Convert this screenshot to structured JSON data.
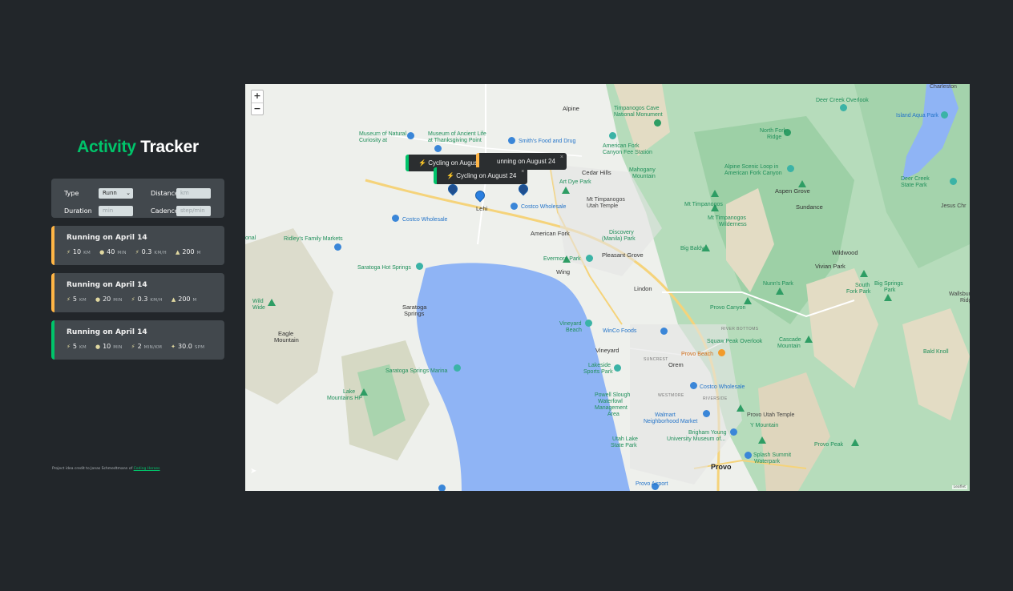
{
  "app": {
    "title_part1": "Activity",
    "title_part2": "Tracker"
  },
  "form": {
    "type_label": "Type",
    "type_value": "Runn",
    "distance_label": "Distance",
    "distance_placeholder": "km",
    "duration_label": "Duration",
    "duration_placeholder": "min",
    "cadence_label": "Cadence",
    "cadence_placeholder": "step/min"
  },
  "workouts": [
    {
      "title": "Running on April 14",
      "type": "running",
      "details": [
        {
          "icon": "runner-icon",
          "value": "10",
          "unit": "KM"
        },
        {
          "icon": "stopwatch-icon",
          "value": "40",
          "unit": "MIN"
        },
        {
          "icon": "lightning-icon",
          "value": "0.3",
          "unit": "KM/H"
        },
        {
          "icon": "mountain-icon",
          "value": "200",
          "unit": "M"
        }
      ]
    },
    {
      "title": "Running on April 14",
      "type": "running",
      "details": [
        {
          "icon": "runner-icon",
          "value": "5",
          "unit": "KM"
        },
        {
          "icon": "stopwatch-icon",
          "value": "20",
          "unit": "MIN"
        },
        {
          "icon": "lightning-icon",
          "value": "0.3",
          "unit": "KM/H"
        },
        {
          "icon": "mountain-icon",
          "value": "200",
          "unit": "M"
        }
      ]
    },
    {
      "title": "Running on April 14",
      "type": "cycling",
      "details": [
        {
          "icon": "runner-icon",
          "value": "5",
          "unit": "KM"
        },
        {
          "icon": "stopwatch-icon",
          "value": "10",
          "unit": "MIN"
        },
        {
          "icon": "lightning-icon",
          "value": "2",
          "unit": "MIN/KM"
        },
        {
          "icon": "footprint-icon",
          "value": "30.0",
          "unit": "SPM"
        }
      ]
    }
  ],
  "credit": {
    "text": "Project idea credit to Jonas Schmedtmann of",
    "link": "Coding Heroes"
  },
  "map": {
    "zoom_in": "+",
    "zoom_out": "−",
    "popups": [
      {
        "text": "Cycling on August 24",
        "type": "cycling"
      },
      {
        "text": "unning on August 24",
        "type": "running"
      },
      {
        "text": "Cycling on August 24",
        "type": "cycling"
      }
    ],
    "labels": {
      "alpine": "Alpine",
      "timpanogos_cave": "Timpanogos Cave",
      "timpanogos_cave2": "National Monument",
      "museum_natural": "Museum of Natural",
      "museum_natural2": "Curiosity at",
      "museum_ancient": "Museum of Ancient Life",
      "museum_ancient2": "at Thanksgiving Point",
      "smiths": "Smith's Food and Drug",
      "american_fork_canyon": "American Fork",
      "american_fork_canyon2": "Canyon Fee Station",
      "cedar_hills": "Cedar Hills",
      "mahogany": "Mahogany",
      "mahogany2": "Mountain",
      "art_dye": "Art Dye Park",
      "mt_timp_temple": "Mt Timpanogos",
      "mt_timp_temple2": "Utah Temple",
      "costco1": "Costco Wholesale",
      "costco2": "Costco Wholesale",
      "lehi": "Lehi",
      "american_fork": "American Fork",
      "discovery": "Discovery",
      "discovery2": "(Manila) Park",
      "ridleys": "Ridley's Family Markets",
      "pleasant_grove": "Pleasant Grove",
      "evermore": "Evermore Park",
      "saratoga_hot": "Saratoga Hot Springs",
      "wing": "Wing",
      "lindon": "Lindon",
      "saratoga_springs": "Saratoga",
      "saratoga_springs2": "Springs",
      "eagle": "Eagle",
      "eagle2": "Mountain",
      "vineyard_beach": "Vineyard",
      "vineyard_beach2": "Beach",
      "winco": "WinCo Foods",
      "vineyard": "Vineyard",
      "orem": "Orem",
      "provo_beach": "Provo Beach",
      "lakeside": "Lakeside",
      "lakeside2": "Sports Park",
      "costco3": "Costco Wholesale",
      "powell": "Powell Slough",
      "powell2": "Waterfowl",
      "powell3": "Management",
      "powell4": "Area",
      "walmart": "Walmart",
      "walmart2": "Neighborhood Market",
      "provo_temple": "Provo Utah Temple",
      "y_mountain": "Y Mountain",
      "byu": "Brigham Young",
      "byu2": "University Museum of...",
      "utah_lake": "Utah Lake",
      "utah_lake2": "State Park",
      "splash": "Splash Summit",
      "splash2": "Waterpark",
      "provo": "Provo",
      "provo_airport": "Provo Airport",
      "saratoga_marina": "Saratoga Springs Marina",
      "lake_mountains": "Lake",
      "lake_mountains2": "Mountains HP",
      "provo_canyon": "Provo Canyon",
      "squaw": "Squaw Peak Overlook",
      "cascade": "Cascade",
      "cascade2": "Mountain",
      "provo_peak": "Provo Peak",
      "big_baldy": "Big Baldy",
      "mt_timp_wild": "Mt Timpanogos",
      "mt_timp_wild2": "Wilderness",
      "mt_timp": "Mt Timpanogos",
      "aspen_grove": "Aspen Grove",
      "sundance": "Sundance",
      "alpine_scenic": "Alpine Scenic Loop in",
      "alpine_scenic2": "American Fork Canyon",
      "north_fork": "North Fork",
      "north_fork2": "Ridge",
      "deer_creek": "Deer Creek Overlook",
      "deer_creek_sp": "Deer Creek",
      "deer_creek_sp2": "State Park",
      "island_aqua": "Island Aqua Park",
      "charleston": "Charleston",
      "jesus_chr": "Jesus Chr",
      "wildwood": "Wildwood",
      "vivian": "Vivian Park",
      "nunns": "Nunn's Park",
      "south_fork": "South",
      "south_fork2": "Fork Park",
      "big_springs": "Big Springs",
      "big_springs2": "Park",
      "wallsburg": "Wallsbur",
      "wallsburg2": "Ridg",
      "bald_knoll": "Bald Knoll",
      "river_bottoms": "RIVER BOTTOMS",
      "suncrest": "SUNCREST",
      "westmore": "WESTMORE",
      "riverside": "RIVERSIDE",
      "wild_wide": "Wild",
      "wild_wide2": "Wide",
      "onal": "onal",
      "attribution": "Leaflet"
    }
  }
}
